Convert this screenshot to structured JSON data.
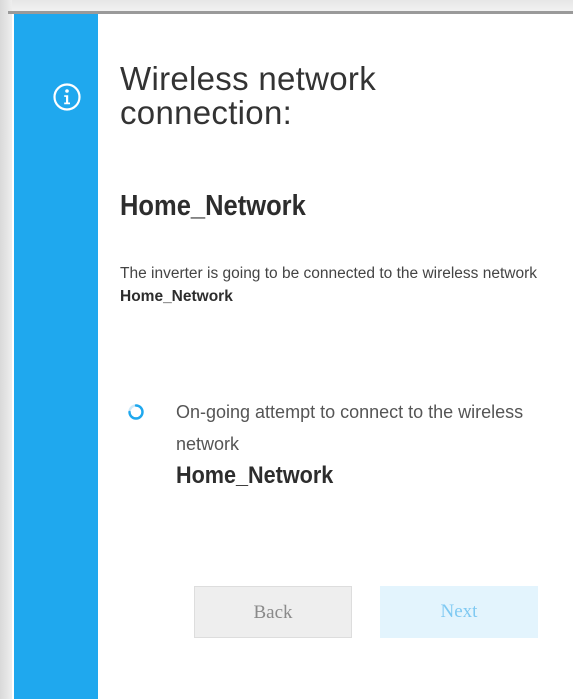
{
  "dialog": {
    "title": "Wireless network connection:",
    "network_name": "Home_Network",
    "description_prefix": "The inverter is going to be connected to the wireless network ",
    "description_network": "Home_Network",
    "status_text": "On-going attempt to connect to the wireless network",
    "status_network": "Home_Network"
  },
  "buttons": {
    "back_label": "Back",
    "next_label": "Next"
  },
  "icons": {
    "sidebar_icon": "info-icon",
    "status_icon": "loading-spinner-icon"
  },
  "colors": {
    "accent": "#1fa8ee",
    "next_bg": "#e3f4fd",
    "back_bg": "#eeeeee"
  }
}
